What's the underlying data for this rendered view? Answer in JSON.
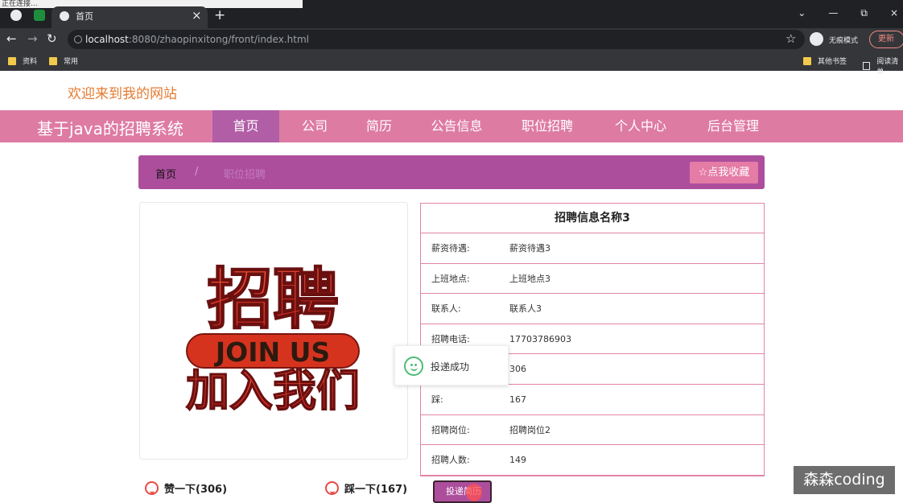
{
  "browser": {
    "status": "正在连接...",
    "tab_title": "首页",
    "new_tab_icon": "plus-icon",
    "address_host": "localhost",
    "address_path": ":8080/zhaopinxitong/front/index.html",
    "incognito_label": "无痕模式",
    "update_label": "更新",
    "bookmarks": [
      "资料",
      "常用",
      "其他书签",
      "阅读清单"
    ],
    "icons": [
      "globe-icon",
      "spreadsheet-icon",
      "close-icon",
      "back-icon",
      "forward-icon",
      "reload-icon",
      "info-icon",
      "star-icon",
      "profile-icon",
      "folder-icon",
      "reading-list-icon"
    ]
  },
  "site": {
    "welcome": "欢迎来到我的网站",
    "title": "基于java的招聘系统",
    "nav": [
      "首页",
      "公司",
      "简历",
      "公告信息",
      "职位招聘",
      "个人中心",
      "后台管理"
    ],
    "breadcrumb": {
      "home": "首页",
      "separator": "/",
      "current": "职位招聘"
    },
    "favorite": "☆点我收藏",
    "detail_title": "招聘信息名称3",
    "details": [
      {
        "label": "薪资待遇:",
        "value": "薪资待遇3"
      },
      {
        "label": "上班地点:",
        "value": "上班地点3"
      },
      {
        "label": "联系人:",
        "value": "联系人3"
      },
      {
        "label": "招聘电话:",
        "value": "17703786903"
      },
      {
        "label": "",
        "value": "306"
      },
      {
        "label": "踩:",
        "value": "167"
      },
      {
        "label": "招聘岗位:",
        "value": "招聘岗位2"
      },
      {
        "label": "招聘人数:",
        "value": "149"
      }
    ],
    "popup": "投递成功",
    "like": "赞一下(306)",
    "dislike": "踩一下(167)",
    "apply": "投递简历",
    "watermark": "森森coding",
    "graphic": {
      "line1": "招聘",
      "line2": "JOIN US",
      "line3": "加入我们"
    },
    "colors": {
      "nav": "#de7ba3",
      "active": "#b15ea6",
      "breadcrumb": "#ad4e9d",
      "accent": "#e47ca5",
      "success": "#4cbc75"
    }
  }
}
